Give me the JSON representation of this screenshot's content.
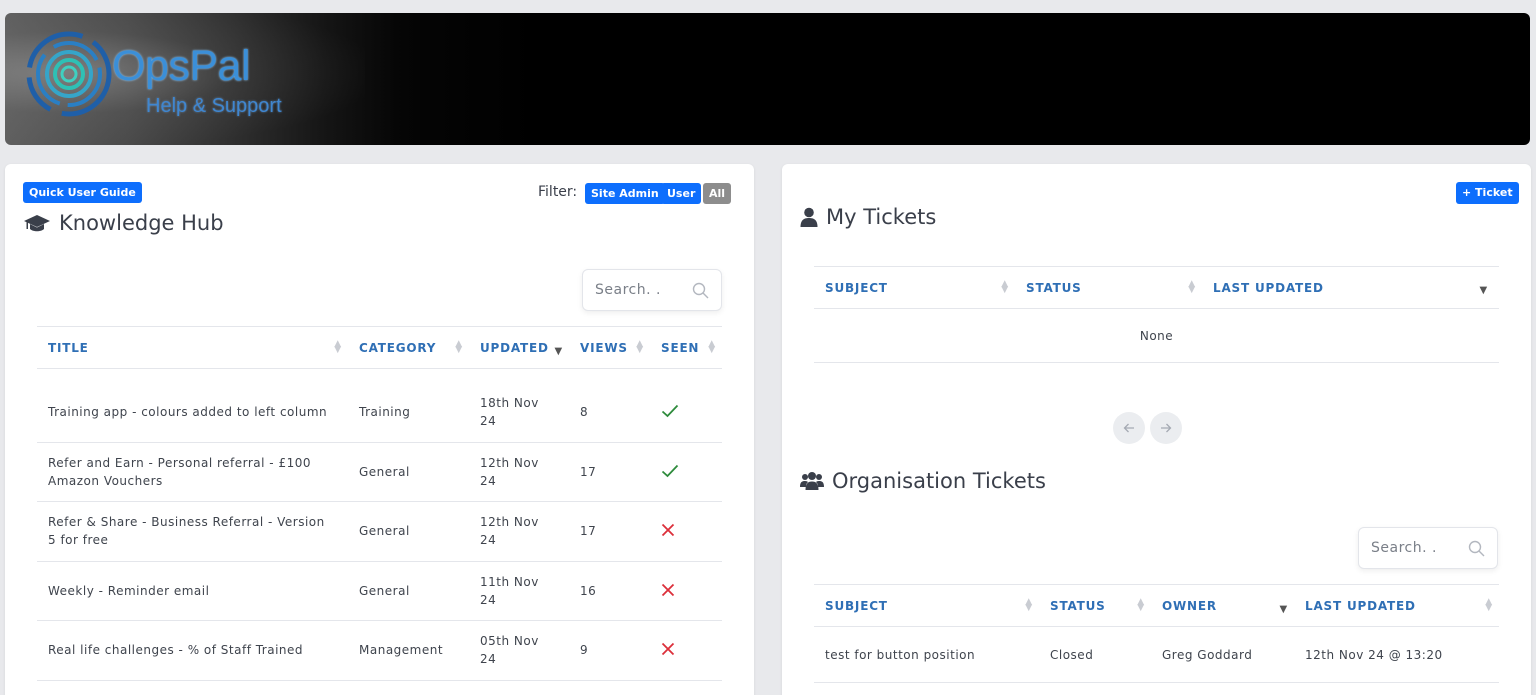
{
  "header": {
    "brand": "OpsPal",
    "subtitle": "Help & Support",
    "logo_icon": "concentric-rings-icon",
    "brand_color": "#3b8fd8"
  },
  "knowledge_hub": {
    "quick_guide_label": "Quick User Guide",
    "filter_label": "Filter:",
    "filters": [
      "Site Admin",
      "User",
      "All"
    ],
    "title": "Knowledge Hub",
    "title_icon": "graduation-cap-icon",
    "search_placeholder": "Search. .",
    "columns": [
      "TITLE",
      "CATEGORY",
      "UPDATED",
      "VIEWS",
      "SEEN"
    ],
    "rows": [
      {
        "title": "Training app - colours added to left column",
        "category": "Training",
        "updated": "18th Nov 24",
        "views": "8",
        "seen": true
      },
      {
        "title": "Refer and Earn - Personal referral - £100 Amazon Vouchers",
        "category": "General",
        "updated": "12th Nov 24",
        "views": "17",
        "seen": true
      },
      {
        "title": "Refer & Share - Business Referral - Version 5 for free",
        "category": "General",
        "updated": "12th Nov 24",
        "views": "17",
        "seen": false
      },
      {
        "title": "Weekly - Reminder email",
        "category": "General",
        "updated": "11th Nov 24",
        "views": "16",
        "seen": false
      },
      {
        "title": "Real life challenges - % of Staff Trained",
        "category": "Management",
        "updated": "05th Nov 24",
        "views": "9",
        "seen": false
      }
    ]
  },
  "my_tickets": {
    "add_label": "+ Ticket",
    "title": "My Tickets",
    "title_icon": "user-icon",
    "columns": [
      "SUBJECT",
      "STATUS",
      "LAST UPDATED"
    ],
    "empty_text": "None"
  },
  "org_tickets": {
    "title": "Organisation Tickets",
    "title_icon": "users-icon",
    "search_placeholder": "Search. .",
    "columns": [
      "SUBJECT",
      "STATUS",
      "OWNER",
      "LAST UPDATED"
    ],
    "rows": [
      {
        "subject": "test for button position",
        "status": "Closed",
        "owner": "Greg Goddard",
        "last_updated": "12th Nov 24 @ 13:20"
      }
    ]
  },
  "colors": {
    "primary": "#0d6efd",
    "header_text": "#2f6fb5",
    "seen_check": "#2e8b3c",
    "unseen_cross": "#dc2f3a"
  }
}
